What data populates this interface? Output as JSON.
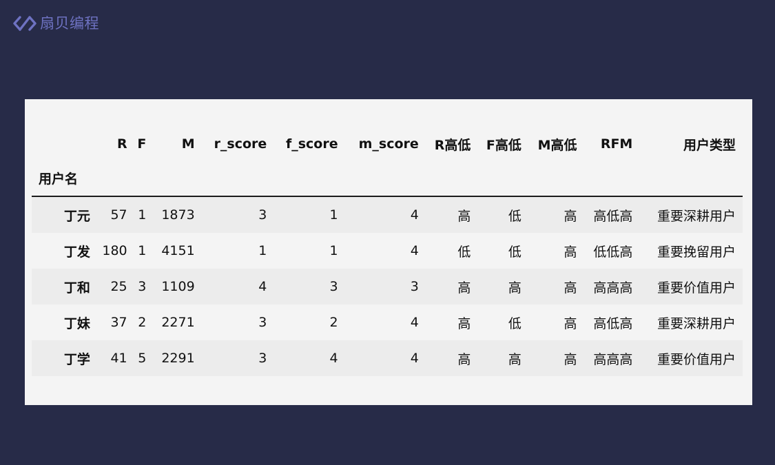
{
  "brand": {
    "name": "扇贝编程",
    "icon": "code-brackets-icon",
    "color": "#6e72c2"
  },
  "table": {
    "columns": [
      "R",
      "F",
      "M",
      "r_score",
      "f_score",
      "m_score",
      "R高低",
      "F高低",
      "M高低",
      "RFM",
      "用户类型"
    ],
    "index_name": "用户名",
    "rows": [
      {
        "name": "丁元",
        "cells": [
          "57",
          "1",
          "1873",
          "3",
          "1",
          "4",
          "高",
          "低",
          "高",
          "高低高",
          "重要深耕用户"
        ]
      },
      {
        "name": "丁发",
        "cells": [
          "180",
          "1",
          "4151",
          "1",
          "1",
          "4",
          "低",
          "低",
          "高",
          "低低高",
          "重要挽留用户"
        ]
      },
      {
        "name": "丁和",
        "cells": [
          "25",
          "3",
          "1109",
          "4",
          "3",
          "3",
          "高",
          "高",
          "高",
          "高高高",
          "重要价值用户"
        ]
      },
      {
        "name": "丁妹",
        "cells": [
          "37",
          "2",
          "2271",
          "3",
          "2",
          "4",
          "高",
          "低",
          "高",
          "高低高",
          "重要深耕用户"
        ]
      },
      {
        "name": "丁学",
        "cells": [
          "41",
          "5",
          "2291",
          "3",
          "4",
          "4",
          "高",
          "高",
          "高",
          "高高高",
          "重要价值用户"
        ]
      }
    ]
  },
  "colors": {
    "background": "#272b48",
    "card": "#f4f4f4",
    "stripe": "#ececec"
  }
}
